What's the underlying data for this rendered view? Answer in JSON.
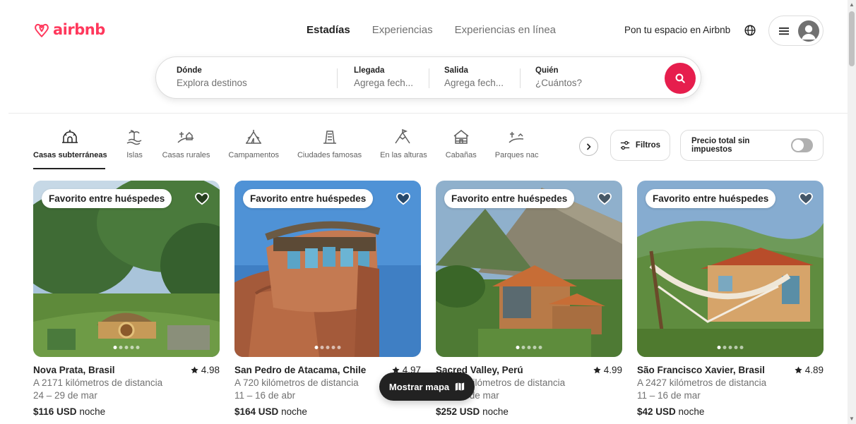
{
  "brand": {
    "name": "airbnb",
    "color": "#FF385C"
  },
  "nav": {
    "tabs": [
      {
        "label": "Estadías"
      },
      {
        "label": "Experiencias"
      },
      {
        "label": "Experiencias en línea"
      }
    ]
  },
  "header": {
    "host_link": "Pon tu espacio en Airbnb",
    "globe_icon": "globe-icon",
    "menu_icon": "hamburger-icon",
    "avatar_icon": "user-avatar-icon"
  },
  "search": {
    "where": {
      "label": "Dónde",
      "placeholder": "Explora destinos"
    },
    "checkin": {
      "label": "Llegada",
      "placeholder": "Agrega fech..."
    },
    "checkout": {
      "label": "Salida",
      "placeholder": "Agrega fech..."
    },
    "who": {
      "label": "Quién",
      "placeholder": "¿Cuántos?"
    },
    "button_icon": "search-icon",
    "button_color": "#E61E4D"
  },
  "categories": {
    "items": [
      {
        "label": "Casas subterráneas",
        "icon": "earth-house-icon"
      },
      {
        "label": "Islas",
        "icon": "island-icon"
      },
      {
        "label": "Casas rurales",
        "icon": "countryside-icon"
      },
      {
        "label": "Campamentos",
        "icon": "camping-icon"
      },
      {
        "label": "Ciudades famosas",
        "icon": "iconic-city-icon"
      },
      {
        "label": "En las alturas",
        "icon": "mountain-top-icon"
      },
      {
        "label": "Cabañas",
        "icon": "cabin-icon"
      },
      {
        "label": "Parques nac",
        "icon": "national-park-icon"
      }
    ],
    "next_icon": "chevron-right-icon"
  },
  "filters": {
    "label": "Filtros",
    "icon": "sliders-icon"
  },
  "price_toggle": {
    "label": "Precio total sin impuestos",
    "on": false
  },
  "listings": [
    {
      "badge": "Favorito entre huéspedes",
      "title": "Nova Prata, Brasil",
      "rating": "4.98",
      "distance": "A 2171 kilómetros de distancia",
      "dates": "24 – 29 de mar",
      "price": "$116 USD",
      "price_unit": "noche"
    },
    {
      "badge": "Favorito entre huéspedes",
      "title": "San Pedro de Atacama, Chile",
      "rating": "4.97",
      "distance": "A 720 kilómetros de distancia",
      "dates": "11 – 16 de abr",
      "price": "$164 USD",
      "price_unit": "noche"
    },
    {
      "badge": "Favorito entre huéspedes",
      "title": "Sacred Valley, Perú",
      "rating": "4.99",
      "distance": "A 2000 kilómetros de distancia",
      "dates": "11 – 16 de mar",
      "price": "$252 USD",
      "price_unit": "noche"
    },
    {
      "badge": "Favorito entre huéspedes",
      "title": "São Francisco Xavier, Brasil",
      "rating": "4.89",
      "distance": "A 2427 kilómetros de distancia",
      "dates": "11 – 16 de mar",
      "price": "$42 USD",
      "price_unit": "noche"
    }
  ],
  "map_button": {
    "label": "Mostrar mapa",
    "icon": "map-icon"
  }
}
